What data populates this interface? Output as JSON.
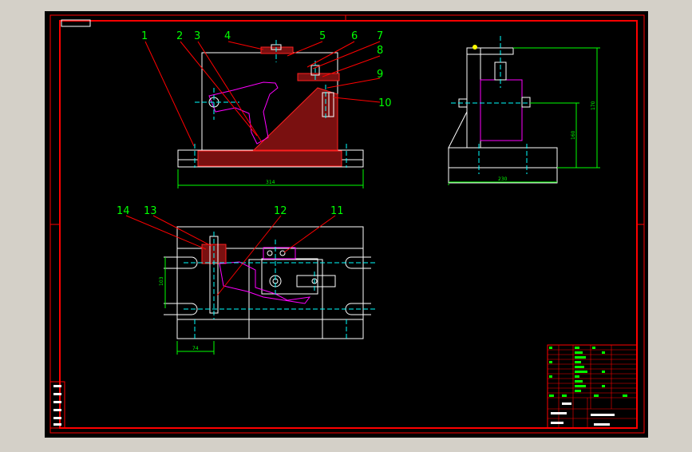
{
  "colors": {
    "background": "#000000",
    "frame": "#ff0000",
    "outline": "#ffffff",
    "centerline": "#00ffff",
    "leader": "#ff0000",
    "dimension": "#00ff00",
    "balloon_text": "#00ff00",
    "hidden": "#ff00ff",
    "hatch": "#ff2020",
    "window": "#d4d0c8"
  },
  "balloons_front": [
    "1",
    "2",
    "3",
    "4",
    "5",
    "6",
    "7",
    "8",
    "9",
    "10"
  ],
  "balloons_top": [
    "14",
    "13",
    "12",
    "11"
  ],
  "dimensions": {
    "front_width": "314",
    "side_height_outer": "170",
    "side_height_inner": "160",
    "side_width": "230",
    "top_height": "103",
    "top_offset": "74"
  }
}
